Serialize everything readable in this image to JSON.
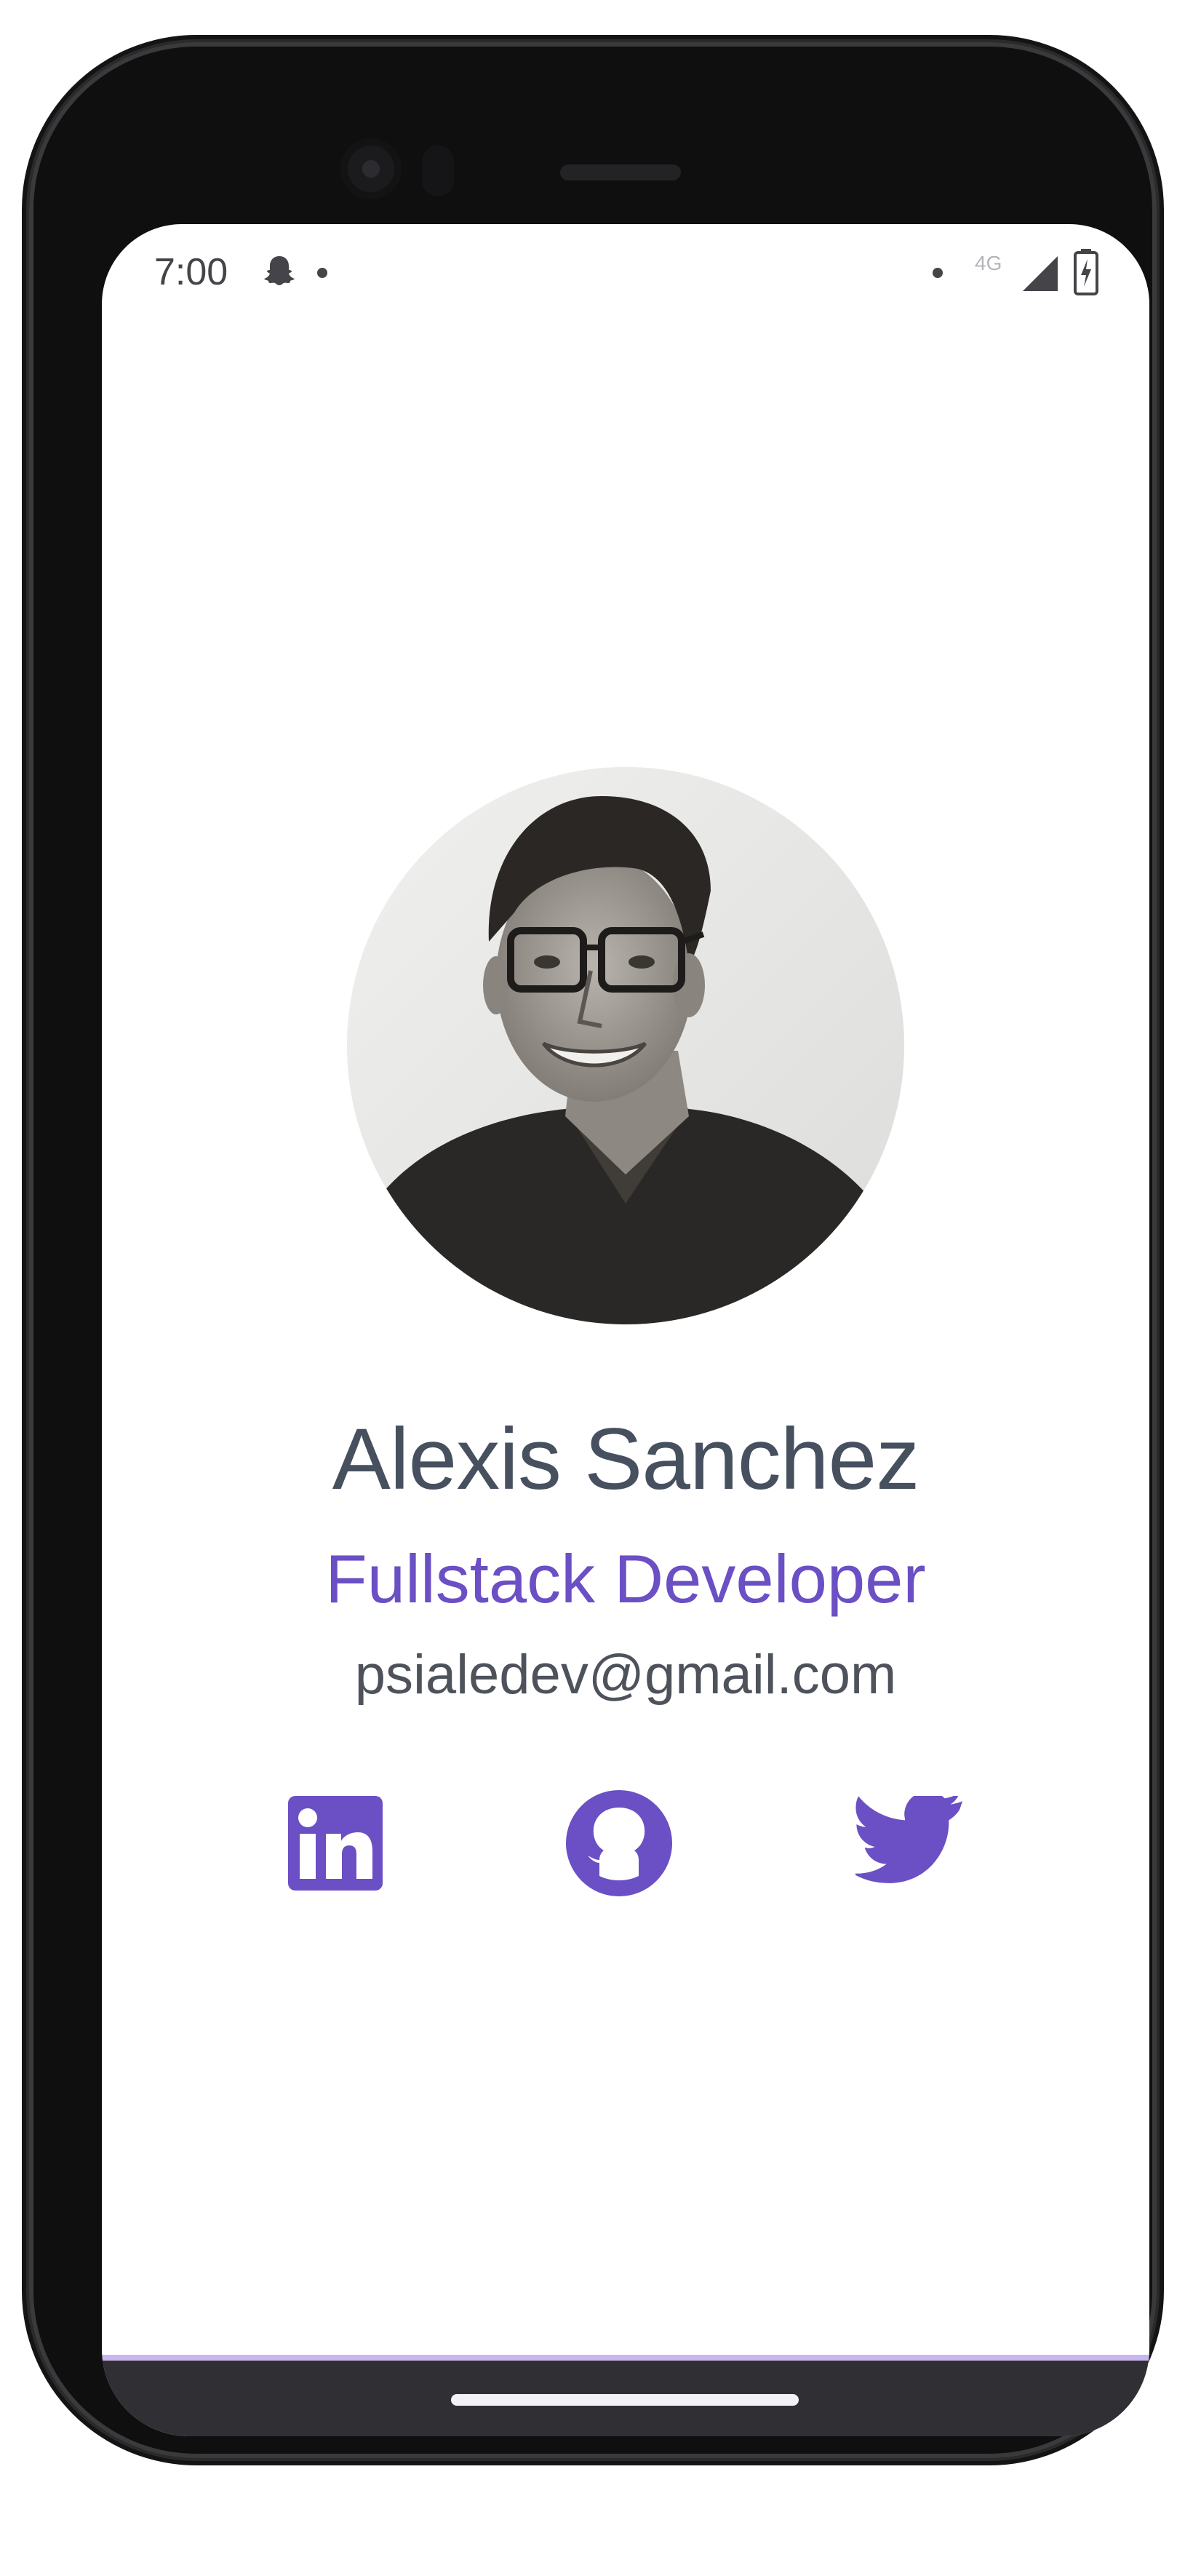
{
  "status_bar": {
    "time": "7:00",
    "network": "4G",
    "icons": [
      "snapchat-ghost-icon",
      "notification-dot-icon",
      "signal-icon",
      "battery-charging-icon"
    ]
  },
  "profile": {
    "avatar_alt": "profile-photo",
    "name": "Alexis Sanchez",
    "role": "Fullstack Developer",
    "email": "psialedev@gmail.com"
  },
  "social_links": [
    {
      "icon": "linkedin-icon"
    },
    {
      "icon": "github-icon"
    },
    {
      "icon": "twitter-icon"
    }
  ],
  "colors": {
    "accent": "#6b4fc4",
    "name_text": "#46505f",
    "email_text": "#4d525b",
    "nav_bar": "#303034",
    "nav_bar_top_border": "#c9b6ee"
  }
}
